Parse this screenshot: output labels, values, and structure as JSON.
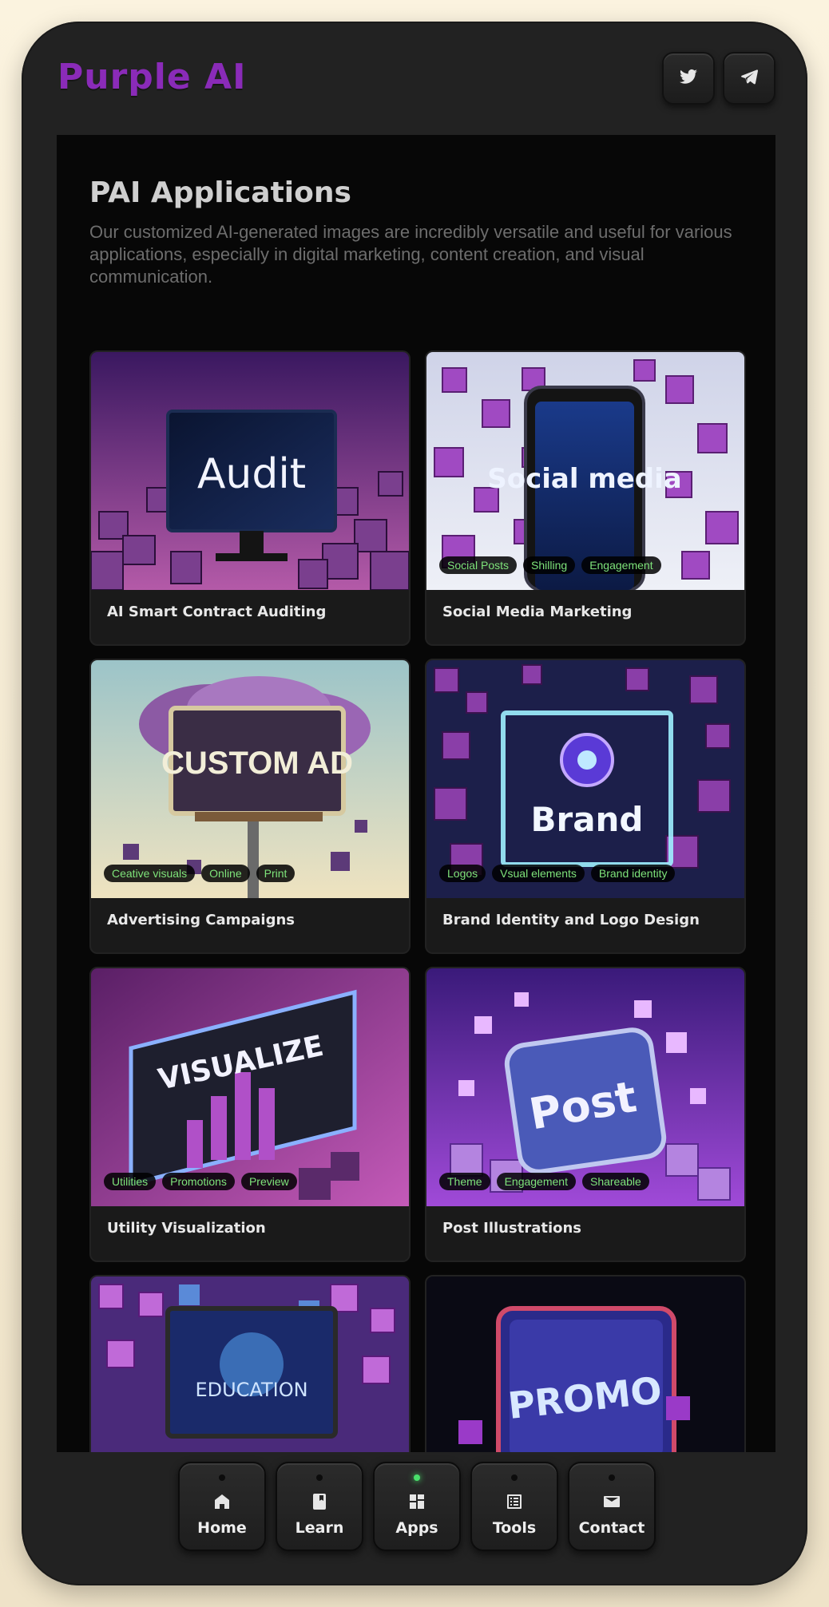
{
  "brand": {
    "name": "Purple AI",
    "color": "#8a2bb8"
  },
  "header": {
    "social": [
      {
        "icon": "twitter-icon"
      },
      {
        "icon": "telegram-icon"
      }
    ]
  },
  "page": {
    "title": "PAI Applications",
    "description": "Our customized AI-generated images are incredibly versatile and useful for various applications, especially in digital marketing, content creation, and visual communication."
  },
  "cards": [
    {
      "label": "AI Smart Contract Auditing",
      "image_text": "Audit",
      "tags": []
    },
    {
      "label": "Social Media Marketing",
      "image_text": "Social media",
      "tags": [
        "Social Posts",
        "Shilling",
        "Engagement"
      ]
    },
    {
      "label": "Advertising Campaigns",
      "image_text": "CUSTOM AD",
      "tags": [
        "Ceative visuals",
        "Online",
        "Print"
      ]
    },
    {
      "label": "Brand Identity and Logo Design",
      "image_text": "Brand",
      "tags": [
        "Logos",
        "Vsual elements",
        "Brand identity"
      ]
    },
    {
      "label": "Utility Visualization",
      "image_text": "VISUALIZE",
      "tags": [
        "Utilities",
        "Promotions",
        "Preview"
      ]
    },
    {
      "label": "Post Illustrations",
      "image_text": "Post",
      "tags": [
        "Theme",
        "Engagement",
        "Shareable"
      ]
    },
    {
      "label": "",
      "image_text": "EDUCATION",
      "tags": []
    },
    {
      "label": "",
      "image_text": "PROMO",
      "tags": []
    }
  ],
  "nav": [
    {
      "label": "Home",
      "icon": "home-icon",
      "active": false
    },
    {
      "label": "Learn",
      "icon": "book-icon",
      "active": false
    },
    {
      "label": "Apps",
      "icon": "apps-grid-icon",
      "active": true
    },
    {
      "label": "Tools",
      "icon": "tools-list-icon",
      "active": false
    },
    {
      "label": "Contact",
      "icon": "mail-icon",
      "active": false
    }
  ],
  "colors": {
    "tag_text": "#7ee37a",
    "active_dot": "#49e06b",
    "accent": "#8a2bb8"
  }
}
